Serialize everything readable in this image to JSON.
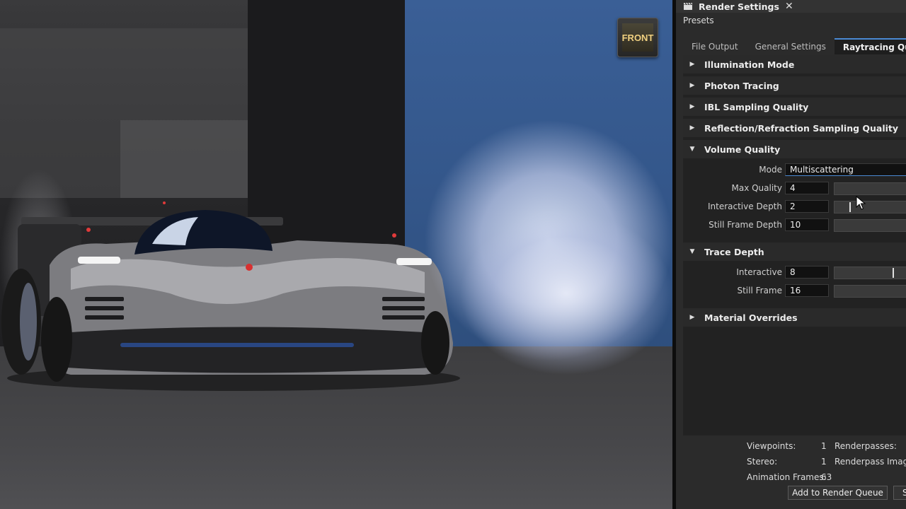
{
  "viewport": {
    "nav_cube_label": "FRONT"
  },
  "panel": {
    "title": "Render Settings",
    "close_glyph": "✕",
    "presets_label": "Presets",
    "tabs": [
      {
        "label": "File Output",
        "active": false
      },
      {
        "label": "General Settings",
        "active": false
      },
      {
        "label": "Raytracing Quality",
        "active": true
      }
    ],
    "sections": {
      "illumination": "Illumination Mode",
      "photon": "Photon Tracing",
      "ibl": "IBL Sampling Quality",
      "reflection": "Reflection/Refraction Sampling Quality",
      "volume": "Volume Quality",
      "trace": "Trace Depth",
      "material": "Material Overrides"
    },
    "volume": {
      "mode_label": "Mode",
      "mode_value": "Multiscattering",
      "max_quality_label": "Max Quality",
      "max_quality_value": "4",
      "interactive_depth_label": "Interactive Depth",
      "interactive_depth_value": "2",
      "still_frame_depth_label": "Still Frame Depth",
      "still_frame_depth_value": "10"
    },
    "trace": {
      "interactive_label": "Interactive",
      "interactive_value": "8",
      "still_frame_label": "Still Frame",
      "still_frame_value": "16"
    },
    "stats": {
      "viewpoints_label": "Viewpoints:",
      "viewpoints_value": "1",
      "stereo_label": "Stereo:",
      "stereo_value": "1",
      "animation_frames_label": "Animation Frames:",
      "animation_frames_value": "63",
      "renderpasses_label": "Renderpasses:",
      "renderpass_images_label": "Renderpass Images"
    },
    "buttons": {
      "add_to_queue": "Add to Render Queue",
      "second_button_partial": "S"
    }
  },
  "colors": {
    "accent": "#4a8ad4",
    "panel_bg": "#2b2b2b",
    "wall_blue": "#34578b"
  }
}
